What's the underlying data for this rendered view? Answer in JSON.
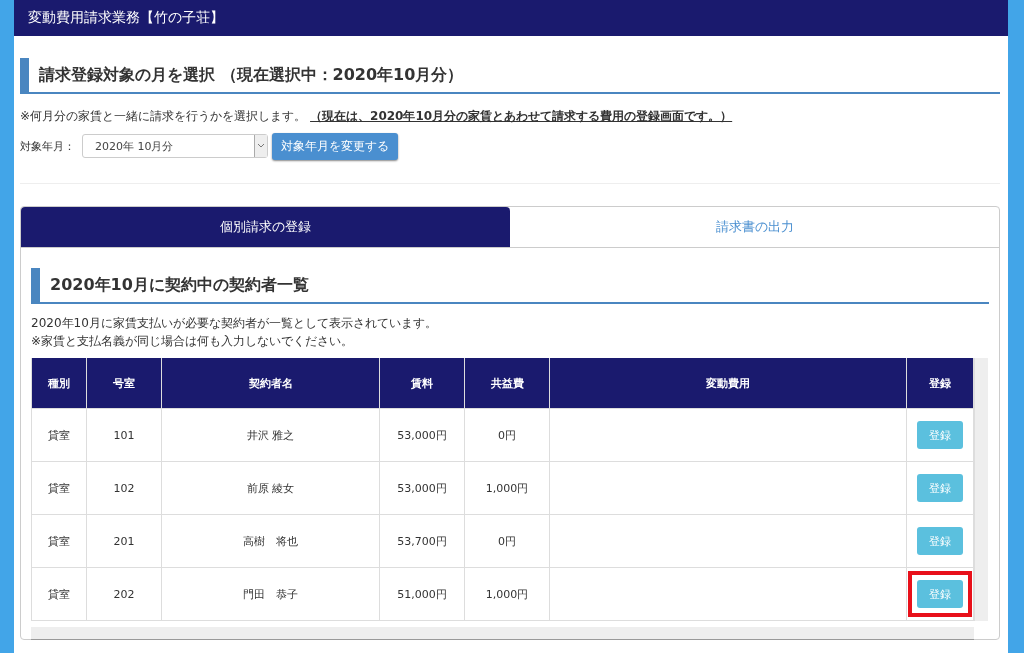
{
  "header": {
    "title": "変動費用請求業務【竹の子荘】"
  },
  "month_section": {
    "heading": "請求登録対象の月を選択 （現在選択中：2020年10月分）",
    "note": "※何月分の家賃と一緒に請求を行うかを選択します。",
    "note_emphasis": "（現在は、2020年10月分の家賃とあわせて請求する費用の登録画面です。）",
    "select_label": "対象年月：",
    "select_value": "2020年 10月分",
    "change_button": "対象年月を変更する"
  },
  "tabs": [
    {
      "label": "個別請求の登録",
      "selected": true
    },
    {
      "label": "請求書の出力",
      "selected": false
    }
  ],
  "list_section": {
    "heading": "2020年10月に契約中の契約者一覧",
    "description": [
      "2020年10月に家賃支払いが必要な契約者が一覧として表示されています。",
      "※家賃と支払名義が同じ場合は何も入力しないでください。"
    ]
  },
  "table": {
    "columns": [
      "種別",
      "号室",
      "契約者名",
      "賃料",
      "共益費",
      "変動費用",
      "登録"
    ],
    "rows": [
      {
        "cells": [
          "貸室",
          "101",
          "井沢 雅之",
          "53,000円",
          "0円",
          ""
        ],
        "button": "登録",
        "highlighted": false
      },
      {
        "cells": [
          "貸室",
          "102",
          "前原 綾女",
          "53,000円",
          "1,000円",
          ""
        ],
        "button": "登録",
        "highlighted": false
      },
      {
        "cells": [
          "貸室",
          "201",
          "高樹　将也",
          "53,700円",
          "0円",
          ""
        ],
        "button": "登録",
        "highlighted": false
      },
      {
        "cells": [
          "貸室",
          "202",
          "門田　恭子",
          "51,000円",
          "1,000円",
          ""
        ],
        "button": "登録",
        "highlighted": true
      }
    ]
  }
}
